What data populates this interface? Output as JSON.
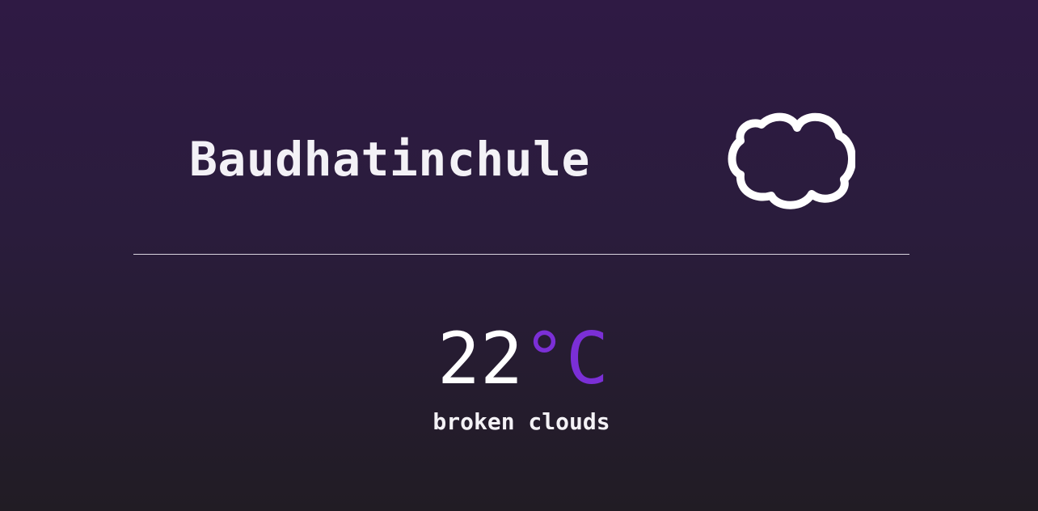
{
  "weather": {
    "city": "Baudhatinchule",
    "icon": "cloud-icon",
    "temperature": "22",
    "unit": "°C",
    "description": "broken clouds"
  },
  "colors": {
    "accent": "#7b2fd6",
    "text": "#ffffff",
    "background_top": "#2f1a44",
    "background_bottom": "#211c24"
  }
}
